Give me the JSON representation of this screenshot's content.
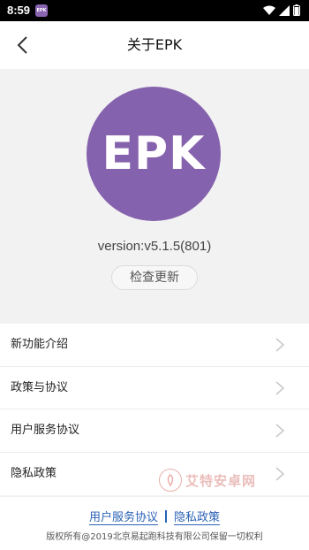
{
  "status_bar": {
    "time": "8:59",
    "app_icon_text": "EPK",
    "icons": [
      "wifi-icon",
      "signal-icon",
      "battery-icon"
    ]
  },
  "header": {
    "title": "关于EPK",
    "back_icon": "chevron-left-icon"
  },
  "hero": {
    "logo_text": "EPK",
    "logo_color": "#8562ad",
    "version": "version:v5.1.5(801)",
    "check_update_label": "检查更新"
  },
  "menu": {
    "items": [
      {
        "label": "新功能介绍"
      },
      {
        "label": "政策与协议"
      },
      {
        "label": "用户服务协议"
      },
      {
        "label": "隐私政策"
      }
    ]
  },
  "watermark": {
    "text": "艾特安卓网"
  },
  "footer": {
    "link_user_agreement": "用户服务协议",
    "link_privacy": "隐私政策",
    "copyright": "版权所有@2019北京易起跑科技有限公司保留一切权利",
    "link_color": "#2b62b5"
  }
}
